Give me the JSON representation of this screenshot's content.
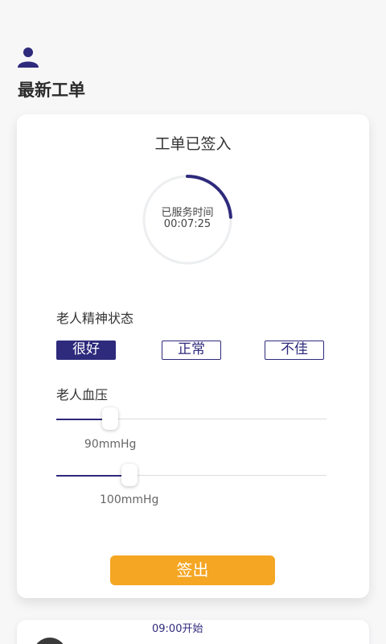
{
  "header": {
    "user_icon": "user-icon",
    "title": "最新工单"
  },
  "order_card": {
    "title": "工单已签入",
    "timer": {
      "label": "已服务时间",
      "value": "00:07:25",
      "progress_fraction": 0.24,
      "accent_color": "#2e2a7c"
    },
    "mood": {
      "label": "老人精神状态",
      "options": [
        "很好",
        "正常",
        "不佳"
      ],
      "selected": "很好"
    },
    "blood_pressure": {
      "label": "老人血压",
      "low": {
        "value": "90mmHg",
        "fraction": 0.2
      },
      "high": {
        "value": "100mmHg",
        "fraction": 0.27
      }
    },
    "signout_label": "签出",
    "signout_color": "#f5a623"
  },
  "next_card": {
    "time": "09:00开始",
    "avatar_icon": "avatar"
  }
}
